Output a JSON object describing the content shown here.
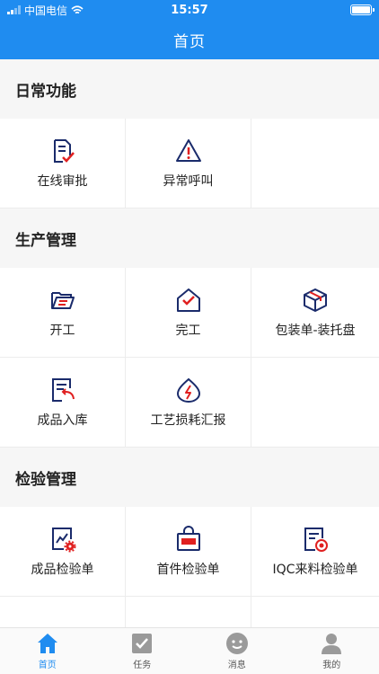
{
  "status_bar": {
    "carrier": "中国电信",
    "time": "15:57"
  },
  "header": {
    "title": "首页"
  },
  "sections": [
    {
      "title": "日常功能",
      "items": [
        {
          "label": "在线审批",
          "icon": "approval-document-icon"
        },
        {
          "label": "异常呼叫",
          "icon": "warning-triangle-icon"
        }
      ]
    },
    {
      "title": "生产管理",
      "items": [
        {
          "label": "开工",
          "icon": "open-folder-icon"
        },
        {
          "label": "完工",
          "icon": "house-check-icon"
        },
        {
          "label": "包装单-装托盘",
          "icon": "package-box-icon"
        },
        {
          "label": "成品入库",
          "icon": "stock-in-document-icon"
        },
        {
          "label": "工艺损耗汇报",
          "icon": "lightning-drop-icon"
        }
      ]
    },
    {
      "title": "检验管理",
      "items": [
        {
          "label": "成品检验单",
          "icon": "chart-gear-icon"
        },
        {
          "label": "首件检验单",
          "icon": "first-bag-icon"
        },
        {
          "label": "IQC来料检验单",
          "icon": "inspection-stamp-icon"
        }
      ]
    }
  ],
  "tabbar": [
    {
      "label": "首页",
      "icon": "home-icon",
      "active": true
    },
    {
      "label": "任务",
      "icon": "task-check-icon",
      "active": false
    },
    {
      "label": "消息",
      "icon": "message-smile-icon",
      "active": false
    },
    {
      "label": "我的",
      "icon": "user-profile-icon",
      "active": false
    }
  ],
  "colors": {
    "accent": "#1f8cf0",
    "icon_navy": "#1a2b6b",
    "icon_red": "#e02020"
  }
}
